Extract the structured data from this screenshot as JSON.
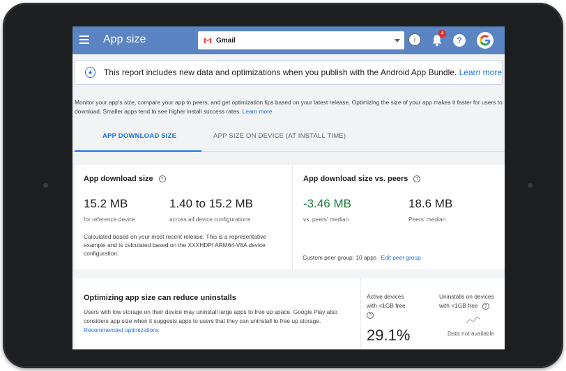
{
  "header": {
    "title": "App size",
    "app_selector": {
      "selected": "Gmail"
    },
    "info_icon": "i",
    "notification_count": "4",
    "help_icon": "?"
  },
  "banner": {
    "text": "This report includes new data and optimizations when you publish with the Android App Bundle.",
    "link": "Learn more"
  },
  "intro": {
    "text": "Monitor your app's size, compare your app to peers, and get optimization tips based on your latest release. Optimizing the size of your app makes it faster for users to download. Smaller apps tend to see higher install success rates.",
    "link": "Learn more"
  },
  "tabs": [
    {
      "label": "APP DOWNLOAD SIZE",
      "active": true
    },
    {
      "label": "APP SIZE ON DEVICE (AT INSTALL TIME)",
      "active": false
    }
  ],
  "download_size": {
    "title": "App download size",
    "reference_value": "15.2 MB",
    "reference_label": "for reference device",
    "range_value": "1.40 to 15.2 MB",
    "range_label": "across all device configurations",
    "description": "Calculated based on your most recent release. This is a representative example and is calculated based on the XXXHDPI ARM64-V8A device configuration."
  },
  "peers": {
    "title": "App download size vs. peers",
    "diff_value": "-3.46 MB",
    "diff_label": "vs. peers' median",
    "median_value": "18.6 MB",
    "median_label": "Peers' median",
    "peer_group_text": "Custom peer group: 10 apps",
    "edit_link": "Edit peer group"
  },
  "uninstalls": {
    "title": "Optimizing app size can reduce uninstalls",
    "text": "Users with low storage on their device may uninstall large apps to free up space. Google Play also considers app size when it suggests apps to users that they can uninstall to free up storage.",
    "link": "Recommended optimizations",
    "active_label_1": "Active devices",
    "active_label_2": "with <1GB free",
    "active_value": "29.1%",
    "uninstall_label_1": "Uninstalls on devices",
    "uninstall_label_2": "with <1GB free",
    "not_available": "Data not available"
  },
  "colors": {
    "appbar": "#5b84c2",
    "link": "#1a73e8",
    "positive": "#188038",
    "badge": "#d93025"
  }
}
